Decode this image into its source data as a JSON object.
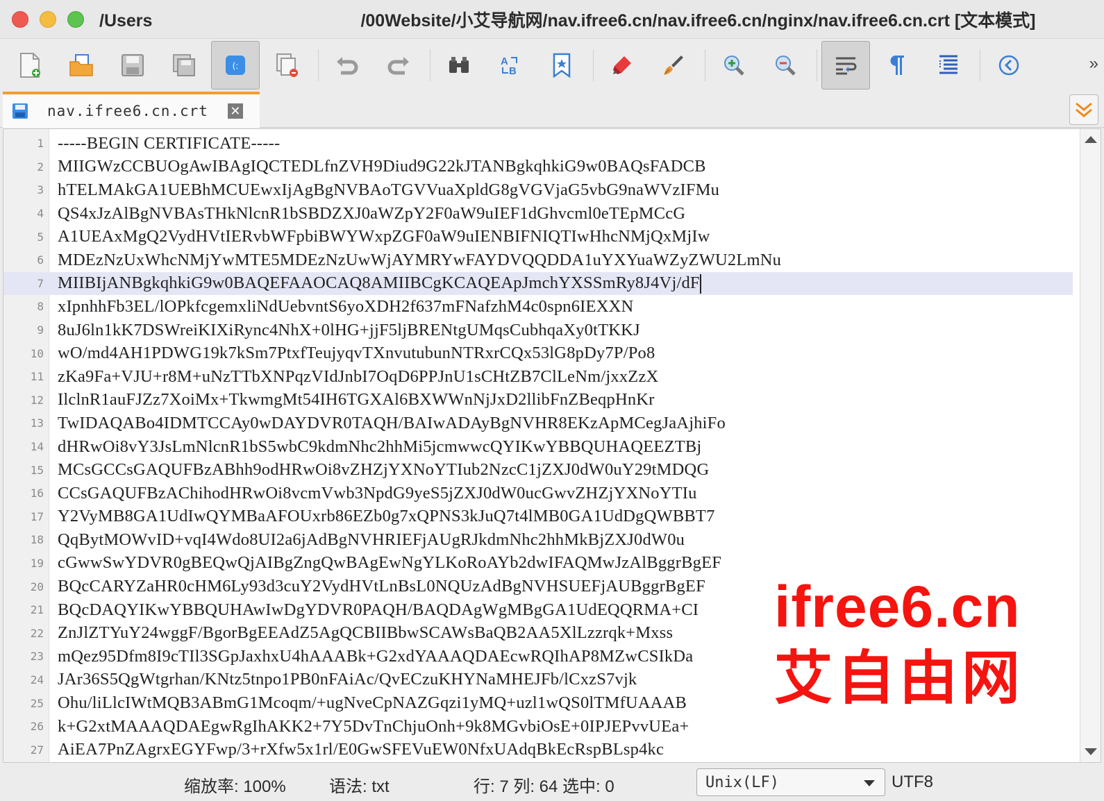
{
  "window": {
    "title_left": "/Users",
    "title_right": "/00Website/小艾导航网/nav.ifree6.cn/nav.ifree6.cn/nginx/nav.ifree6.cn.crt [文本模式]"
  },
  "toolbar": {
    "more": "»"
  },
  "tab": {
    "label": "nav.ifree6.cn.crt",
    "close": "✕"
  },
  "editor": {
    "lines": [
      {
        "n": "1",
        "text": "-----BEGIN CERTIFICATE-----"
      },
      {
        "n": "2",
        "text": "MIIGWzCCBUOgAwIBAgIQCTEDLfnZVH9Diud9G22kJTANBgkqhkiG9w0BAQsFADCB"
      },
      {
        "n": "3",
        "text": "hTELMAkGA1UEBhMCUEwxIjAgBgNVBAoTGVVuaXpldG8gVGVjaG5vbG9naWVzIFMu"
      },
      {
        "n": "4",
        "text": "QS4xJzAlBgNVBAsTHkNlcnR1bSBDZXJ0aWZpY2F0aW9uIEF1dGhvcml0eTEpMCcG"
      },
      {
        "n": "5",
        "text": "A1UEAxMgQ2VydHVtIERvbWFpbiBWYWxpZGF0aW9uIENBIFNIQTIwHhcNMjQxMjIw"
      },
      {
        "n": "6",
        "text": "MDEzNzUxWhcNMjYwMTE5MDEzNzUwWjAYMRYwFAYDVQQDDA1uYXYuaWZyZWU2LmNu"
      },
      {
        "n": "7",
        "text": "MIIBIjANBgkqhkiG9w0BAQEFAAOCAQ8AMIIBCgKCAQEApJmchYXSSmRy8J4Vj/dF"
      },
      {
        "n": "8",
        "text": "xIpnhhFb3EL/lOPkfcgemxliNdUebvntS6yoXDH2f637mFNafzhM4c0spn6IEXXN"
      },
      {
        "n": "9",
        "text": "8uJ6ln1kK7DSWreiKIXiRync4NhX+0lHG+jjF5ljBRENtgUMqsCubhqaXy0tTKKJ"
      },
      {
        "n": "10",
        "text": "wO/md4AH1PDWG19k7kSm7PtxfTeujyqvTXnvutubunNTRxrCQx53lG8pDy7P/Po8"
      },
      {
        "n": "11",
        "text": "zKa9Fa+VJU+r8M+uNzTTbXNPqzVIdJnbI7OqD6PPJnU1sCHtZB7ClLeNm/jxxZzX"
      },
      {
        "n": "12",
        "text": "IlclnR1auFJZz7XoiMx+TkwmgMt54IH6TGXAl6BXWWnNjJxD2llibFnZBeqpHnKr"
      },
      {
        "n": "13",
        "text": "TwIDAQABo4IDMTCCAy0wDAYDVR0TAQH/BAIwADAyBgNVHR8EKzApMCegJaAjhiFo"
      },
      {
        "n": "14",
        "text": "dHRwOi8vY3JsLmNlcnR1bS5wbC9kdmNhc2hhMi5jcmwwcQYIKwYBBQUHAQEEZTBj"
      },
      {
        "n": "15",
        "text": "MCsGCCsGAQUFBzABhh9odHRwOi8vZHZjYXNoYTIub2NzcC1jZXJ0dW0uY29tMDQG"
      },
      {
        "n": "16",
        "text": "CCsGAQUFBzAChihodHRwOi8vcmVwb3NpdG9yeS5jZXJ0dW0ucGwvZHZjYXNoYTIu"
      },
      {
        "n": "17",
        "text": "Y2VyMB8GA1UdIwQYMBaAFOUxrb86EZb0g7xQPNS3kJuQ7t4lMB0GA1UdDgQWBBT7"
      },
      {
        "n": "18",
        "text": "QqBytMOWvID+vqI4Wdo8UI2a6jAdBgNVHRIEFjAUgRJkdmNhc2hhMkBjZXJ0dW0u"
      },
      {
        "n": "19",
        "text": "cGwwSwYDVR0gBEQwQjAIBgZngQwBAgEwNgYLKoRoAYb2dwIFAQMwJzAlBggrBgEF"
      },
      {
        "n": "20",
        "text": "BQcCARYZaHR0cHM6Ly93d3cuY2VydHVtLnBsL0NQUzAdBgNVHSUEFjAUBggrBgEF"
      },
      {
        "n": "21",
        "text": "BQcDAQYIKwYBBQUHAwIwDgYDVR0PAQH/BAQDAgWgMBgGA1UdEQQRMA+CI"
      },
      {
        "n": "22",
        "text": "ZnJlZTYuY24wggF/BgorBgEEAdZ5AgQCBIIBbwSCAWsBaQB2AA5XlLzzrqk+Mxss"
      },
      {
        "n": "23",
        "text": "mQez95Dfm8I9cTIl3SGpJaxhxU4hAAABk+G2xdYAAAQDAEcwRQIhAP8MZwCSIkDa"
      },
      {
        "n": "24",
        "text": "JAr36S5QgWtgrhan/KNtz5tnpo1PB0nFAiAc/QvECzuKHYNaMHEJFb/lCxzS7vjk"
      },
      {
        "n": "25",
        "text": "Ohu/liLlcIWtMQB3ABmG1Mcoqm/+ugNveCpNAZGqzi1yMQ+uzl1wQS0lTMfUAAAB"
      },
      {
        "n": "26",
        "text": "k+G2xtMAAAQDAEgwRgIhAKK2+7Y5DvTnChjuOnh+9k8MGvbiOsE+0IPJEPvvUEa+"
      },
      {
        "n": "27",
        "text": "AiEA7PnZAgrxEGYFwp/3+rXfw5x1rl/E0GwSFEVuEW0NfxUAdqBkEcRspBLsp4kc"
      }
    ],
    "current_line": 7
  },
  "watermark": {
    "line1": "ifree6.cn",
    "line2": "艾自由网"
  },
  "status": {
    "zoom": "缩放率: 100%",
    "syntax": "语法:  txt",
    "position": "行:  7 列:  64 选中:  0",
    "line_ending": "Unix(LF)",
    "encoding": "UTF8"
  },
  "colors": {
    "tab_accent": "#f39c32",
    "watermark": "#f5140f",
    "current_line": "#e4e6f5"
  }
}
